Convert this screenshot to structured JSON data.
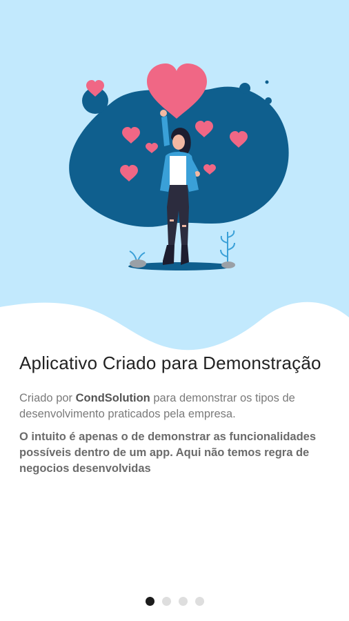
{
  "colors": {
    "sky": "#c2e9fd",
    "blob": "#0f5f8e",
    "heart": "#f06785",
    "ground": "#0f5f8e",
    "dot_active": "#1c1c1c",
    "dot_inactive": "#dedede"
  },
  "hero": {
    "illustration": "woman-with-hearts-illustration"
  },
  "onboarding": {
    "title": "Aplicativo Criado para Demonstração",
    "description": {
      "prefix": "Criado por ",
      "brand": "CondSolution",
      "suffix": " para demonstrar os tipos de desenvolvimento praticados pela empresa."
    },
    "note": "O intuito é apenas o de demonstrar as funcionalidades possíveis dentro de um app. Aqui não temos regra de negocios desenvolvidas"
  },
  "pager": {
    "total": 4,
    "current": 1
  }
}
